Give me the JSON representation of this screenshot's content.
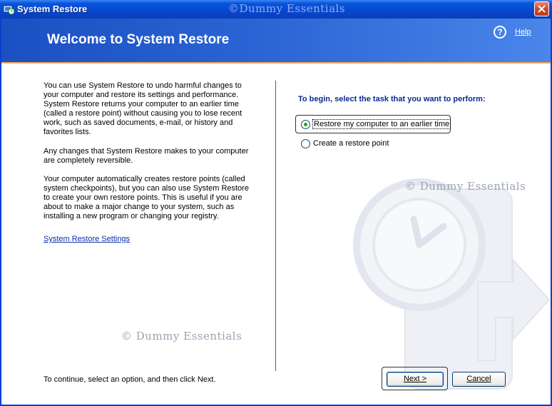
{
  "window": {
    "title": "System Restore",
    "watermark": "©Dummy Essentials"
  },
  "header": {
    "title": "Welcome to System Restore",
    "help_label": "Help"
  },
  "left": {
    "paragraphs": [
      "You can use System Restore to undo harmful changes to your computer and restore its settings and performance. System Restore returns your computer to an earlier time (called a restore point) without causing you to lose recent work, such as saved documents, e-mail, or history and favorites lists.",
      "Any changes that System Restore makes to your computer are completely reversible.",
      "Your computer automatically creates restore points (called system checkpoints), but you can also use System Restore to create your own restore points. This is useful if you are about to make a major change to your system, such as installing a new program or changing your registry."
    ],
    "settings_link": "System Restore Settings",
    "watermark": "© Dummy Essentials",
    "continue_text": "To continue, select an option, and then click Next."
  },
  "right": {
    "prompt": "To begin, select the task that you want to perform:",
    "options": [
      {
        "label": "Restore my computer to an earlier time",
        "selected": true
      },
      {
        "label": "Create a restore point",
        "selected": false
      }
    ],
    "watermark": "© Dummy Essentials"
  },
  "buttons": {
    "next": "Next >",
    "cancel": "Cancel"
  },
  "colors": {
    "title_bar": "#0846cf",
    "header_band": "#2a63d3",
    "prompt_text": "#0b2a8f",
    "link": "#0b2fa6",
    "divider": "#3b5bb8"
  }
}
